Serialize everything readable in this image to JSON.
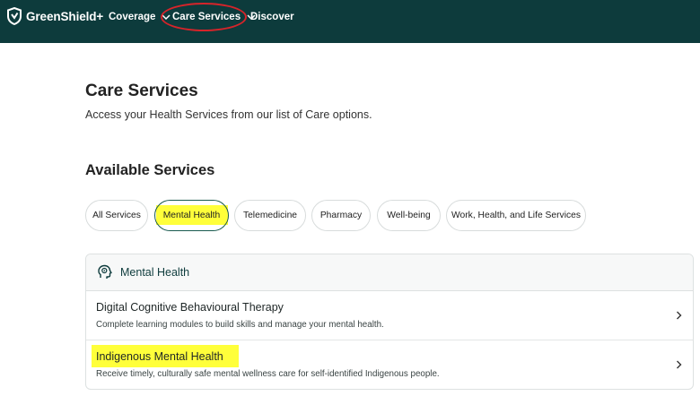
{
  "brand": {
    "name": "GreenShield+"
  },
  "nav": {
    "items": [
      {
        "label": "Coverage"
      },
      {
        "label": "Care Services"
      },
      {
        "label": "Discover"
      }
    ]
  },
  "header": {
    "title": "Care Services",
    "subtitle": "Access your Health Services from our list of Care options."
  },
  "services": {
    "title": "Available Services",
    "filters": [
      {
        "label": "All Services"
      },
      {
        "label": "Mental Health"
      },
      {
        "label": "Telemedicine"
      },
      {
        "label": "Pharmacy"
      },
      {
        "label": "Well-being"
      },
      {
        "label": "Work, Health, and Life Services"
      }
    ],
    "selected_filter": "Mental Health"
  },
  "category": {
    "title": "Mental Health",
    "icon": "head-brain-icon",
    "items": [
      {
        "title": "Digital Cognitive Behavioural Therapy",
        "description": "Complete learning modules to build skills and manage your mental health."
      },
      {
        "title": "Indigenous Mental Health",
        "description": "Receive timely, culturally safe mental wellness care for self-identified Indigenous people."
      }
    ]
  },
  "colors": {
    "topbar": "#0d3b3c",
    "highlight": "#ffff3a",
    "annotation": "#d6242a",
    "active_chip_border": "#1a5a4f"
  }
}
